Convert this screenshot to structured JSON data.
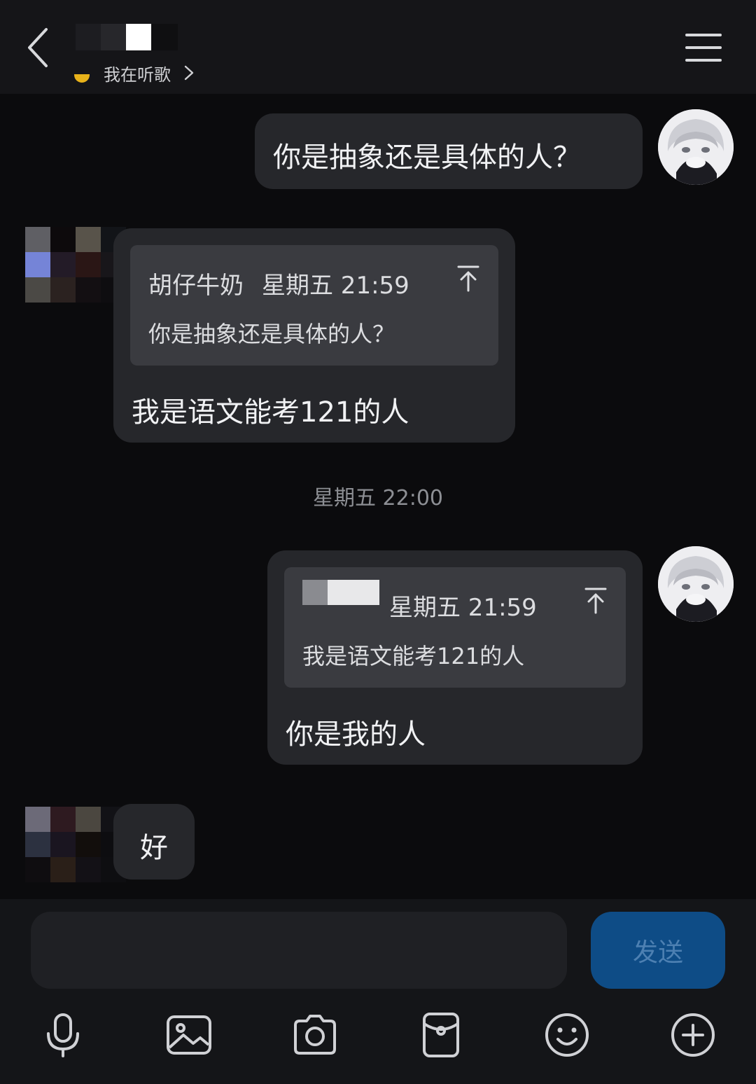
{
  "header": {
    "contact_name": "",
    "status_text": "我在听歌"
  },
  "messages": [
    {
      "side": "right",
      "text": "你是抽象还是具体的人？"
    },
    {
      "side": "left",
      "quote": {
        "author": "胡仔牛奶",
        "time": "星期五 21:59",
        "text": "你是抽象还是具体的人？"
      },
      "text": "我是语文能考121的人"
    },
    {
      "type": "time",
      "text": "星期五 22:00"
    },
    {
      "side": "right",
      "quote": {
        "author": "",
        "time": "星期五 21:59",
        "text": "我是语文能考121的人"
      },
      "text": "你是我的人"
    },
    {
      "side": "left",
      "text": "好"
    }
  ],
  "composer": {
    "placeholder": "",
    "send_label": "发送",
    "icons": [
      "microphone-icon",
      "image-icon",
      "camera-icon",
      "red-packet-icon",
      "emoji-icon",
      "plus-icon"
    ]
  },
  "colors": {
    "background": "#0b0b0d",
    "bubble": "#26272b",
    "quote": "#3a3b40",
    "send_button": "#0e4c86",
    "status_emoji": "#e8b21a"
  }
}
